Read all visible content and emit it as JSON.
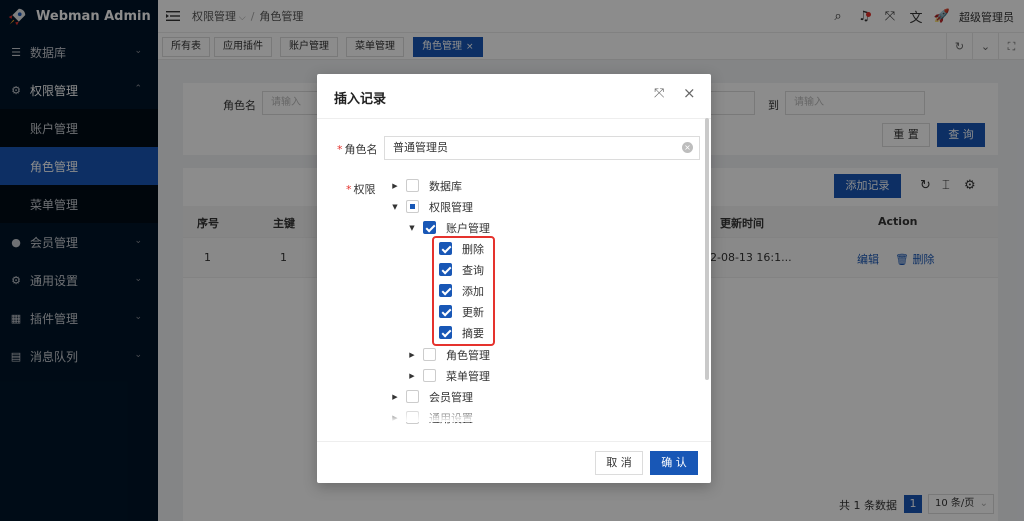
{
  "app": {
    "title": "Webman Admin"
  },
  "sidebar": {
    "items": [
      {
        "label": "数据库",
        "icon": "database-icon"
      },
      {
        "label": "权限管理",
        "icon": "gear-icon"
      },
      {
        "label": "会员管理",
        "icon": "user-icon"
      },
      {
        "label": "通用设置",
        "icon": "gear-icon"
      },
      {
        "label": "插件管理",
        "icon": "grid-icon"
      },
      {
        "label": "消息队列",
        "icon": "queue-icon"
      }
    ],
    "sub_items": [
      {
        "label": "账户管理"
      },
      {
        "label": "角色管理"
      },
      {
        "label": "菜单管理"
      }
    ]
  },
  "header": {
    "breadcrumb": [
      "权限管理",
      "角色管理"
    ],
    "user": "超级管理员"
  },
  "tabs": [
    {
      "label": "所有表"
    },
    {
      "label": "应用插件"
    },
    {
      "label": "账户管理"
    },
    {
      "label": "菜单管理"
    },
    {
      "label": "角色管理"
    }
  ],
  "search": {
    "label": "角色名",
    "placeholder": "请输入",
    "to": "到",
    "reset": "重 置",
    "query": "查 询"
  },
  "table": {
    "add_button": "添加记录",
    "columns": [
      "序号",
      "主键",
      "更新时间",
      "Action"
    ],
    "rows": [
      {
        "index": "1",
        "id": "1",
        "updated": "2-08-13 16:1...",
        "edit": "编辑",
        "delete": "删除"
      }
    ],
    "pager": {
      "total": "共 1 条数据",
      "page": "1",
      "size": "10 条/页"
    }
  },
  "modal": {
    "title": "插入记录",
    "role_label": "角色名",
    "role_value": "普通管理员",
    "perm_label": "权限",
    "tree": [
      {
        "label": "数据库"
      },
      {
        "label": "权限管理"
      },
      {
        "label": "账户管理"
      },
      {
        "label": "删除"
      },
      {
        "label": "查询"
      },
      {
        "label": "添加"
      },
      {
        "label": "更新"
      },
      {
        "label": "摘要"
      },
      {
        "label": "角色管理"
      },
      {
        "label": "菜单管理"
      },
      {
        "label": "会员管理"
      },
      {
        "label": "通用设置"
      }
    ],
    "cancel": "取 消",
    "confirm": "确 认"
  },
  "colors": {
    "primary": "#1857b6",
    "sidebar": "#001529",
    "highlight": "#e5322d"
  }
}
